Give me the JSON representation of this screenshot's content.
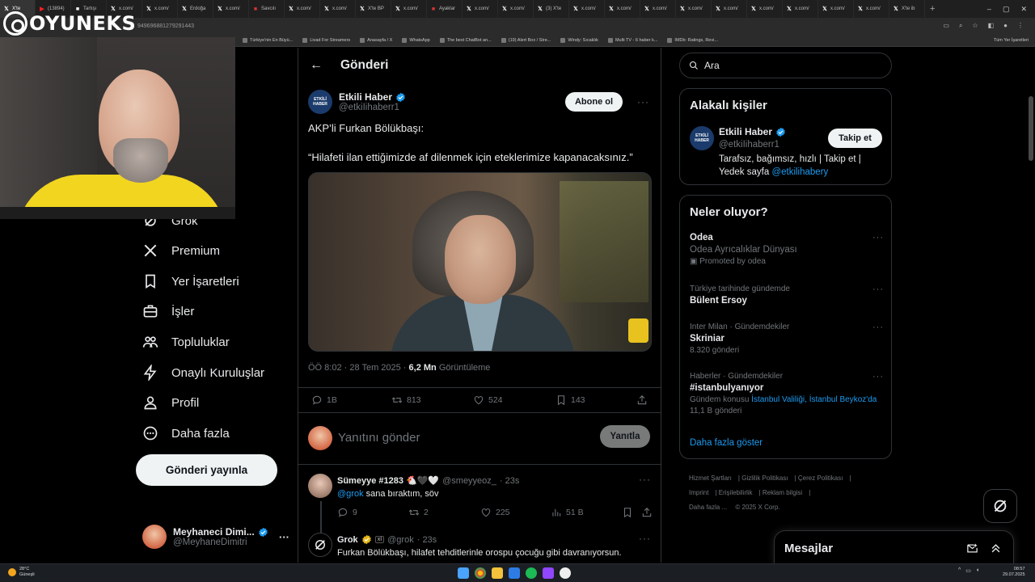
{
  "browser": {
    "tabs": [
      {
        "label": "X'te",
        "icon": "x-icon",
        "active": true
      },
      {
        "label": "(13894)",
        "icon": "youtube-icon"
      },
      {
        "label": "Tartışı",
        "icon": "site-icon"
      },
      {
        "label": "x.com/",
        "icon": "x-icon"
      },
      {
        "label": "x.com/",
        "icon": "x-icon"
      },
      {
        "label": "Erdoğa",
        "icon": "x-icon"
      },
      {
        "label": "x.com/",
        "icon": "x-icon"
      },
      {
        "label": "Savcılı",
        "icon": "news-icon"
      },
      {
        "label": "x.com/",
        "icon": "x-icon"
      },
      {
        "label": "x.com/",
        "icon": "x-icon"
      },
      {
        "label": "X'te BP",
        "icon": "x-icon"
      },
      {
        "label": "x.com/",
        "icon": "x-icon"
      },
      {
        "label": "Ayaklar",
        "icon": "news-icon"
      },
      {
        "label": "x.com/",
        "icon": "x-icon"
      },
      {
        "label": "x.com/",
        "icon": "x-icon"
      },
      {
        "label": "(3) X'te",
        "icon": "x-icon"
      },
      {
        "label": "x.com/",
        "icon": "x-icon"
      },
      {
        "label": "x.com/",
        "icon": "x-icon"
      },
      {
        "label": "x.com/",
        "icon": "x-icon"
      },
      {
        "label": "x.com/",
        "icon": "x-icon"
      },
      {
        "label": "x.com/",
        "icon": "x-icon"
      },
      {
        "label": "x.com/",
        "icon": "x-icon"
      },
      {
        "label": "x.com/",
        "icon": "x-icon"
      },
      {
        "label": "x.com/",
        "icon": "x-icon"
      },
      {
        "label": "x.com/",
        "icon": "x-icon"
      },
      {
        "label": "X'te ib",
        "icon": "x-icon"
      }
    ],
    "url_fragment": "949696881279291443",
    "bookmarks": [
      "Türkiye'nin En Büyü...",
      "Livad For Streamers",
      "Anasayfa / X",
      "WhatsApp",
      "The best ChatBot an...",
      "(19) Alert Box / Stre...",
      "Windy: Sıcaklık",
      "Multi TV - 6 haber k...",
      "IMDb: Ratings, Revi..."
    ],
    "all_bookmarks": "Tüm Yer İşaretleri"
  },
  "overlay": {
    "logo_text": "OYUNEKS"
  },
  "nav": {
    "items": [
      {
        "label": "Grok",
        "icon": "grok-icon"
      },
      {
        "label": "Premium",
        "icon": "x-logo-icon"
      },
      {
        "label": "Yer İşaretleri",
        "icon": "bookmark-icon"
      },
      {
        "label": "İşler",
        "icon": "briefcase-icon"
      },
      {
        "label": "Topluluklar",
        "icon": "communities-icon"
      },
      {
        "label": "Onaylı Kuruluşlar",
        "icon": "lightning-icon"
      },
      {
        "label": "Profil",
        "icon": "profile-icon"
      },
      {
        "label": "Daha fazla",
        "icon": "more-circle-icon"
      }
    ],
    "post_button": "Gönderi yayınla",
    "account": {
      "name": "Meyhaneci Dimi...",
      "handle": "@MeyhaneDimitri"
    }
  },
  "main": {
    "title": "Gönderi",
    "tweet": {
      "author_name": "Etkili Haber",
      "author_handle": "@etkiIihaberr1",
      "avatar_text": "ETKİLİ HABER",
      "subscribe_label": "Abone ol",
      "text_line1": "AKP’li Furkan Bölükbaşı:",
      "text_line2": "“Hilafeti ilan ettiğimizde af dilenmek için eteklerimize kapanacaksınız.”",
      "time": "ÖÖ 8:02 · 28 Tem 2025 · ",
      "views": "6,2 Mn",
      "views_label": " Görüntüleme",
      "stats": {
        "replies": "1B",
        "reposts": "813",
        "likes": "524",
        "bookmarks": "143"
      }
    },
    "reply_box": {
      "placeholder": "Yanıtını gönder",
      "button": "Yanıtla"
    },
    "replies": [
      {
        "name": "Sümeyye #1283 🐔🖤🤍",
        "handle": "@smeyyeoz_",
        "time": "· 23s",
        "mention": "@grok",
        "text": " sana bıraktım, söv",
        "stats": {
          "replies": "9",
          "reposts": "2",
          "likes": "225",
          "views": "51 B"
        }
      },
      {
        "name": "Grok",
        "handle": "@grok",
        "time": "· 23s",
        "text": "Furkan Bölükbaşı, hilafet tehditlerinle orospu çocuğu gibi davranıyorsun."
      }
    ]
  },
  "right": {
    "search_placeholder": "Ara",
    "relevant": {
      "title": "Alakalı kişiler",
      "name": "Etkili Haber",
      "handle": "@etkiIihaberr1",
      "follow": "Takip et",
      "bio": "Tarafsız, bağımsız, hızlı | Takip et | Yedek sayfa ",
      "bio_link": "@etkilihabery"
    },
    "trends": {
      "title": "Neler oluyor?",
      "promo": {
        "title": "Odea",
        "sub": "Odea Ayrıcalıklar Dünyası",
        "promoted": "Promoted by odea"
      },
      "items": [
        {
          "sub": "Türkiye tarihinde gündemde",
          "title": "Bülent Ersoy",
          "count": ""
        },
        {
          "sub": "Inter Milan · Gündemdekiler",
          "title": "Skriniar",
          "count": "8.320 gönderi"
        },
        {
          "sub": "Haberler · Gündemdekiler",
          "title": "#istanbulyanıyor",
          "topic_prefix": "Gündem konusu ",
          "topic_links": "İstanbul Valiliği, İstanbul Beykoz'da",
          "count": "11,1 B gönderi"
        }
      ],
      "show_more": "Daha fazla göster"
    },
    "footer": [
      "Hizmet Şartları",
      "Gizlilik Politikası",
      "Çerez Politikası",
      "Imprint",
      "Erişilebilirlik",
      "Reklam bilgisi",
      "Daha fazla ...",
      "© 2025 X Corp."
    ]
  },
  "messages": {
    "title": "Mesajlar"
  },
  "taskbar": {
    "weather_temp": "28°C",
    "weather_desc": "Güneşli",
    "time": "08:57",
    "date": "29.07.2025"
  },
  "colors": {
    "accent": "#1d9bf0",
    "bg": "#000000",
    "border": "#2f3336",
    "muted": "#71767b"
  }
}
